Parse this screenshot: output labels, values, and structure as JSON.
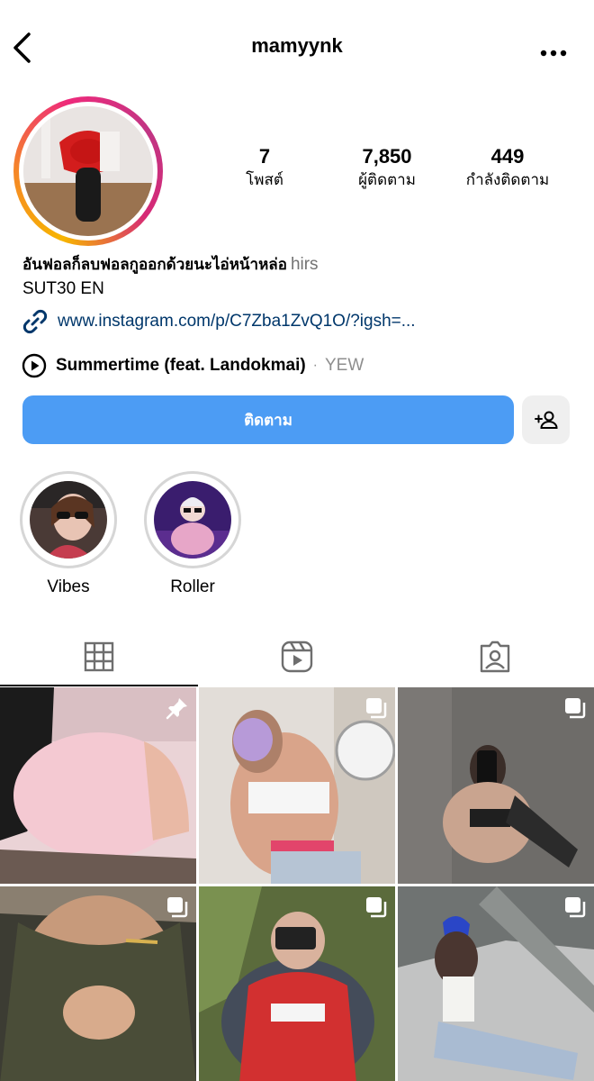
{
  "header": {
    "username": "mamyynk",
    "back_icon": "chevron-left-icon",
    "more_icon": "more-horizontal-icon"
  },
  "profile": {
    "stats": [
      {
        "value": "7",
        "label": "โพสต์"
      },
      {
        "value": "7,850",
        "label": "ผู้ติดตาม"
      },
      {
        "value": "449",
        "label": "กำลังติดตาม"
      }
    ],
    "display_name": "อันฟอลก็ลบฟอลกูออกด้วยนะไอ่หน้าหล่อ",
    "pronouns": "hirs",
    "bio": "SUT30 EN",
    "link": "www.instagram.com/p/C7Zba1ZvQ1O/?igsh=...",
    "music": {
      "title": "Summertime (feat. Landokmai)",
      "separator": "·",
      "artist": "YEW"
    }
  },
  "actions": {
    "follow_label": "ติดตาม",
    "suggest_icon": "add-person-icon"
  },
  "highlights": [
    {
      "label": "Vibes"
    },
    {
      "label": "Roller"
    }
  ],
  "tabs": [
    {
      "icon": "grid-icon",
      "active": true
    },
    {
      "icon": "reels-icon",
      "active": false
    },
    {
      "icon": "tagged-icon",
      "active": false
    }
  ],
  "colors": {
    "accent": "#4c9cf4",
    "link": "#00376b",
    "muted": "#737373"
  }
}
